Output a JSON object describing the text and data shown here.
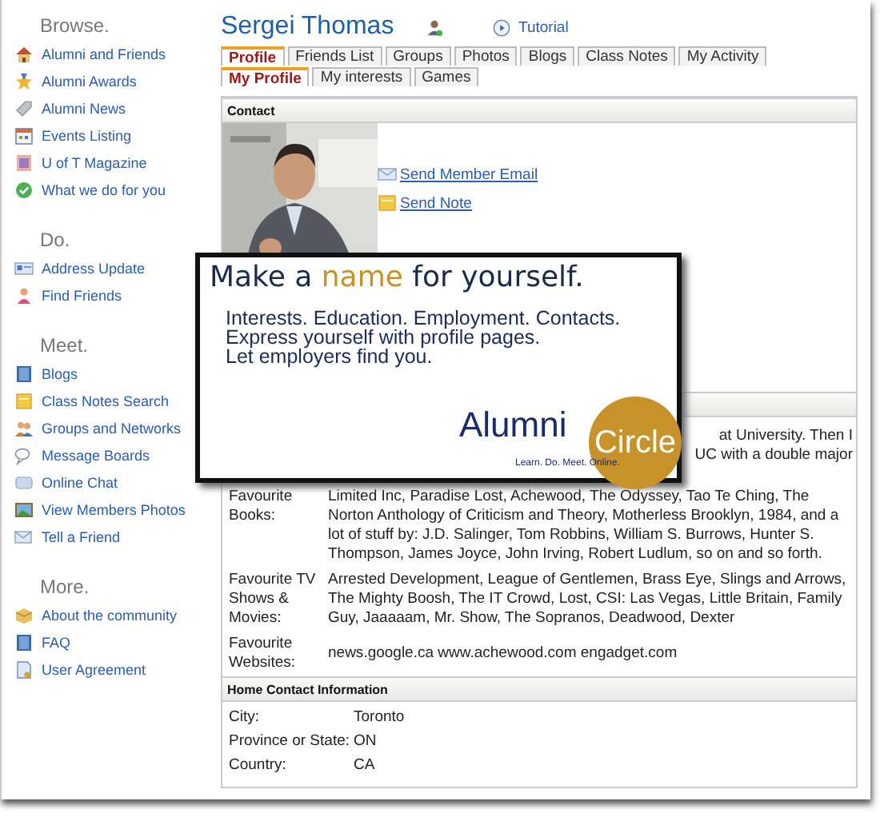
{
  "sidebar": {
    "sections": [
      {
        "heading": "Browse.",
        "items": [
          {
            "label": "Alumni and Friends"
          },
          {
            "label": "Alumni Awards"
          },
          {
            "label": "Alumni News"
          },
          {
            "label": "Events Listing"
          },
          {
            "label": "U of T Magazine"
          },
          {
            "label": "What we do for you"
          }
        ]
      },
      {
        "heading": "Do.",
        "items": [
          {
            "label": "Address Update"
          },
          {
            "label": "Find Friends"
          }
        ]
      },
      {
        "heading": "Meet.",
        "items": [
          {
            "label": "Blogs"
          },
          {
            "label": "Class Notes Search"
          },
          {
            "label": "Groups and Networks"
          },
          {
            "label": "Message Boards"
          },
          {
            "label": "Online Chat"
          },
          {
            "label": "View Members Photos"
          },
          {
            "label": "Tell a Friend"
          }
        ]
      },
      {
        "heading": "More.",
        "items": [
          {
            "label": "About the community"
          },
          {
            "label": "FAQ"
          },
          {
            "label": "User Agreement"
          }
        ]
      }
    ]
  },
  "profile": {
    "name": "Sergei Thomas",
    "tutorial": "Tutorial"
  },
  "tabs": [
    {
      "label": "Profile",
      "selected": true
    },
    {
      "label": "Friends List",
      "selected": false
    },
    {
      "label": "Groups",
      "selected": false
    },
    {
      "label": "Photos",
      "selected": false
    },
    {
      "label": "Blogs",
      "selected": false
    },
    {
      "label": "Class Notes",
      "selected": false
    },
    {
      "label": "My Activity",
      "selected": false
    }
  ],
  "subtabs": [
    {
      "label": "My Profile",
      "selected": true
    },
    {
      "label": "My interests",
      "selected": false
    },
    {
      "label": "Games",
      "selected": false
    }
  ],
  "contact": {
    "heading": "Contact",
    "links": [
      {
        "label": "Send Member Email"
      },
      {
        "label": "Send Note"
      }
    ]
  },
  "about_me": {
    "fragments": [
      "at University. Then I",
      "UC with a double major"
    ]
  },
  "details": [
    {
      "label": "Favourite Books:",
      "value": "Limited Inc, Paradise Lost, Achewood, The Odyssey, Tao Te Ching, The Norton Anthology of Criticism and Theory, Motherless Brooklyn, 1984, and a lot of stuff by: J.D. Salinger, Tom Robbins, William S. Burrows, Hunter S. Thompson, James Joyce, John Irving, Robert Ludlum, so on and so forth."
    },
    {
      "label": "Favourite TV Shows & Movies:",
      "value": "Arrested Development, League of Gentlemen, Brass Eye, Slings and Arrows, The Mighty Boosh, The IT Crowd, Lost, CSI: Las Vegas, Little Britain, Family Guy, Jaaaaam, Mr. Show, The Sopranos, Deadwood, Dexter"
    },
    {
      "label": "Favourite Websites:",
      "value": "news.google.ca www.achewood.com engadget.com"
    }
  ],
  "home_contact": {
    "heading": "Home Contact Information",
    "rows": [
      {
        "label": "City:",
        "value": "Toronto"
      },
      {
        "label": "Province or State:",
        "value": "ON"
      },
      {
        "label": "Country:",
        "value": "CA"
      }
    ]
  },
  "promo": {
    "headline_start": "Make a ",
    "headline_accent": "name",
    "headline_end": " for yourself.",
    "lines": [
      "Interests. Education. Employment. Contacts.",
      "Express yourself with profile pages.",
      "Let employers find you."
    ],
    "logo_word": "Alumni",
    "logo_circle": "Circle",
    "tagline": "Learn. Do. Meet. Online."
  }
}
